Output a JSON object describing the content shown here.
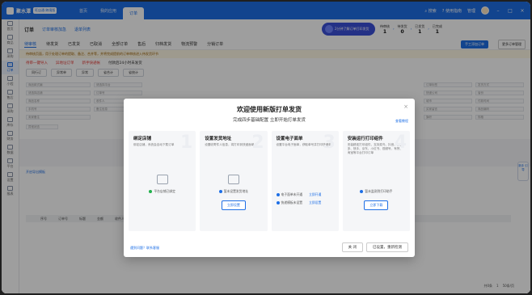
{
  "topbar": {
    "brand_name": "聚水潭",
    "brand_tag": "旺店通·跨境版",
    "tabs": [
      "首页",
      "我的应用",
      "订单"
    ],
    "search": "搜索",
    "guide": "使用指南",
    "user": "管理"
  },
  "sidebar": {
    "items": [
      "首页",
      "商品",
      "采购",
      "订单",
      "小程",
      "售后",
      "采购",
      "库存",
      "财务",
      "数据",
      "平台",
      "设置",
      "报表"
    ]
  },
  "header": {
    "title": "订单",
    "sub1": "订单审核加急",
    "sub2": "退单列表",
    "promo": "2分钟了解订单打印发货",
    "steps": [
      {
        "label": "待审核",
        "n": "1"
      },
      {
        "label": "待发货",
        "n": "0"
      },
      {
        "label": "已发货",
        "n": "1"
      },
      {
        "label": "已完成",
        "n": "1"
      }
    ]
  },
  "tabs": {
    "items": [
      "待审核",
      "待发货",
      "已发货",
      "已取消",
      "全部订单",
      "售后",
      "归档发货",
      "物流预警",
      "分销订单"
    ],
    "btn_primary": "手工添加订单",
    "btn_default": "更多订单管理"
  },
  "notice": "待审核页面，用于处理订单的提取、备注、合并等，并将完成提前的订单审核进入待发货环节",
  "warn_bar": {
    "item1": "待审一键导入",
    "item2": "异地址订单",
    "item3": "新手快递帐",
    "item4": "付款后24小时未发货"
  },
  "chips": [
    "同行订",
    "异常单",
    "异常",
    "省合计",
    "省统计"
  ],
  "filters": [
    "商品款式编",
    "请选择平台",
    "请选择店铺",
    "订单号",
    "商品名称",
    "收件人",
    "手机号",
    "备注信息",
    "卖家备注",
    "异常状态",
    "订单标签",
    "发货方式",
    "快递公司",
    "省份",
    "城市",
    "付款时间",
    "买家留言",
    "商品编码",
    "旗帜",
    "规格"
  ],
  "list": {
    "sub_tab": "开启导出模板",
    "columns": [
      "序号",
      "订单号",
      "标题",
      "金额",
      "收件人",
      "快递公司/单号"
    ],
    "pager": [
      "共0条",
      "1",
      "50条/页"
    ]
  },
  "float_help": "新手\n引导",
  "modal": {
    "title": "欢迎使用新版打单发货",
    "subtitle": "完成四步基础配置 立即开始打单发货",
    "help_link": "查看教程",
    "cards": [
      {
        "num": "1",
        "title": "绑定店铺",
        "desc": "绑定店铺，系统会自动下载订单",
        "status": "平台店铺已绑定",
        "status_type": "ok"
      },
      {
        "num": "2",
        "title": "设置发货地址",
        "desc": "设置收寄件人信息，将打印到快递面单上",
        "status": "暂未设置发货地址",
        "button": "立即设置"
      },
      {
        "num": "3",
        "title": "设置电子面单",
        "desc": "设置平台电子面单，获取单号并打印快递单",
        "row1": "电子面单未开通",
        "row1_link": "立即开通",
        "row2": "快递模板未设置",
        "row2_link": "立即设置"
      },
      {
        "num": "4",
        "title": "安装运行打印组件",
        "desc": "安装精准打印组件，支持菜鸟、抖音、拼多多、快手、京东、小红书、视频号、有赞、淘宝等平台打印订单",
        "status": "暂未监测到打印助手",
        "button": "立即下载"
      }
    ],
    "footer_link": "遇到问题？联系客服",
    "btn_close": "关 闭",
    "btn_done": "已设置，重新检测"
  }
}
